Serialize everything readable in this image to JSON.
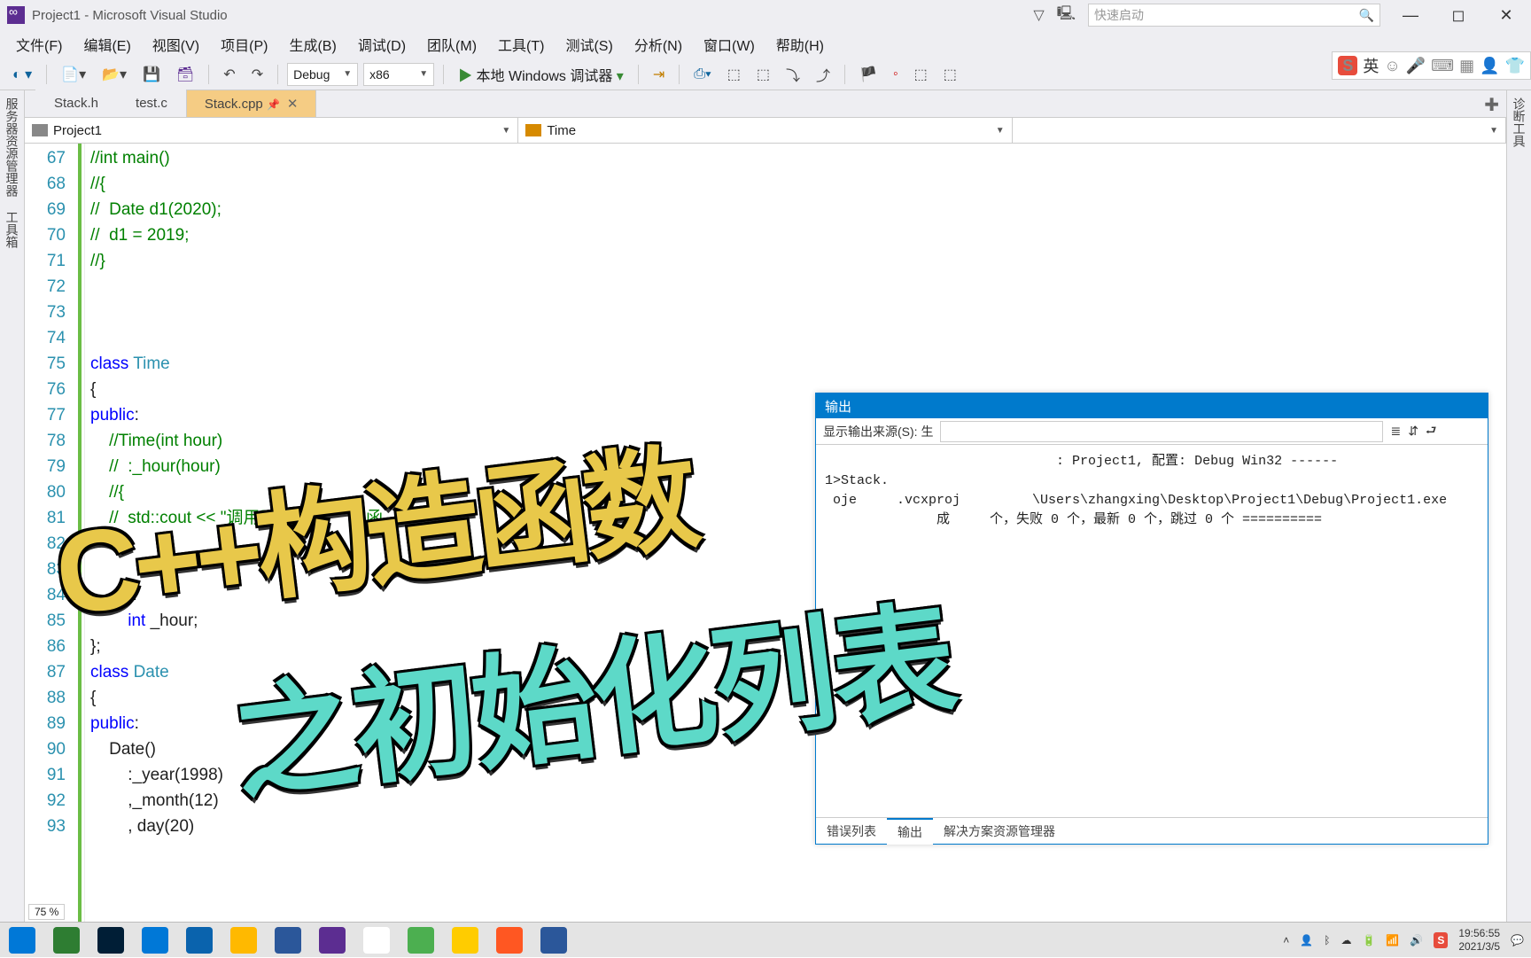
{
  "title": "Project1 - Microsoft Visual Studio",
  "quicklaunch_placeholder": "快速启动",
  "menu": [
    "文件(F)",
    "编辑(E)",
    "视图(V)",
    "项目(P)",
    "生成(B)",
    "调试(D)",
    "团队(M)",
    "工具(T)",
    "测试(S)",
    "分析(N)",
    "窗口(W)",
    "帮助(H)"
  ],
  "config": {
    "build": "Debug",
    "platform": "x86",
    "debugger": "本地 Windows 调试器"
  },
  "tabs": [
    {
      "label": "Stack.h",
      "active": false
    },
    {
      "label": "test.c",
      "active": false
    },
    {
      "label": "Stack.cpp",
      "active": true,
      "pinned": true
    }
  ],
  "nav": {
    "scope": "Project1",
    "member": "Time"
  },
  "left_rail": [
    "服务器资源管理器",
    "工具箱"
  ],
  "right_rail": "诊断工具",
  "line_start": 67,
  "code_lines": [
    {
      "n": 67,
      "seg": [
        {
          "t": "//int main()",
          "c": "cm"
        }
      ]
    },
    {
      "n": 68,
      "seg": [
        {
          "t": "//{",
          "c": "cm"
        }
      ]
    },
    {
      "n": 69,
      "seg": [
        {
          "t": "//  Date d1(2020);",
          "c": "cm"
        }
      ]
    },
    {
      "n": 70,
      "seg": [
        {
          "t": "//  d1 = 2019;",
          "c": "cm"
        }
      ]
    },
    {
      "n": 71,
      "seg": [
        {
          "t": "//}",
          "c": "cm"
        }
      ]
    },
    {
      "n": 72,
      "seg": [
        {
          "t": ""
        }
      ]
    },
    {
      "n": 73,
      "seg": [
        {
          "t": ""
        }
      ]
    },
    {
      "n": 74,
      "seg": [
        {
          "t": ""
        }
      ]
    },
    {
      "n": 75,
      "seg": [
        {
          "t": "class ",
          "c": "kw"
        },
        {
          "t": "Time",
          "c": "tp"
        }
      ]
    },
    {
      "n": 76,
      "seg": [
        {
          "t": "{"
        }
      ]
    },
    {
      "n": 77,
      "seg": [
        {
          "t": "public",
          "c": "kw"
        },
        {
          "t": ":"
        }
      ]
    },
    {
      "n": 78,
      "seg": [
        {
          "t": "    //Time(int hour)",
          "c": "cm"
        }
      ]
    },
    {
      "n": 79,
      "seg": [
        {
          "t": "    //  :_hour(hour)",
          "c": "cm"
        }
      ]
    },
    {
      "n": 80,
      "seg": [
        {
          "t": "    //{",
          "c": "cm"
        }
      ]
    },
    {
      "n": 81,
      "seg": [
        {
          "t": "    //  std::cout << \"调用了Time的    造函   \"       :en",
          "c": "cm"
        }
      ]
    },
    {
      "n": 82,
      "seg": [
        {
          "t": "    //}",
          "c": "cm"
        }
      ]
    },
    {
      "n": 83,
      "seg": [
        {
          "t": ""
        }
      ]
    },
    {
      "n": 84,
      "seg": [
        {
          "t": "      te:"
        }
      ]
    },
    {
      "n": 85,
      "seg": [
        {
          "t": "        int",
          "c": "kw"
        },
        {
          "t": " _hour;"
        }
      ]
    },
    {
      "n": 86,
      "seg": [
        {
          "t": "};"
        }
      ]
    },
    {
      "n": 87,
      "seg": [
        {
          "t": "class ",
          "c": "kw"
        },
        {
          "t": "Date",
          "c": "tp"
        }
      ]
    },
    {
      "n": 88,
      "seg": [
        {
          "t": "{"
        }
      ]
    },
    {
      "n": 89,
      "seg": [
        {
          "t": "public",
          "c": "kw"
        },
        {
          "t": ":"
        }
      ]
    },
    {
      "n": 90,
      "seg": [
        {
          "t": "    Date()"
        }
      ]
    },
    {
      "n": 91,
      "seg": [
        {
          "t": "        :_year(1998)"
        }
      ]
    },
    {
      "n": 92,
      "seg": [
        {
          "t": "        ,_month(12)"
        }
      ]
    },
    {
      "n": 93,
      "seg": [
        {
          "t": "        , day(20)"
        }
      ]
    }
  ],
  "zoom": "75 %",
  "output": {
    "title": "输出",
    "toolbar_label": "显示输出来源(S): 生",
    "lines": [
      "                             : Project1, 配置: Debug Win32 ------",
      "1>Stack.",
      " oje     .vcxproj         \\Users\\zhangxing\\Desktop\\Project1\\Debug\\Project1.exe",
      "              成     个，失败 0 个，最新 0 个，跳过 0 个 =========="
    ],
    "tabs": [
      "错误列表",
      "输出",
      "解决方案资源管理器"
    ],
    "active_tab": 1
  },
  "overlay": {
    "line1": "C++构造函数",
    "line2": "之初始化列表"
  },
  "taskbar": {
    "items": [
      {
        "name": "start",
        "bg": "#0078d7"
      },
      {
        "name": "translate",
        "bg": "#2e7d32"
      },
      {
        "name": "photoshop",
        "bg": "#001e36"
      },
      {
        "name": "vscode",
        "bg": "#0078d7"
      },
      {
        "name": "edge",
        "bg": "#0a63ad"
      },
      {
        "name": "explorer",
        "bg": "#ffb900"
      },
      {
        "name": "pdf",
        "bg": "#2b579a"
      },
      {
        "name": "visualstudio",
        "bg": "#5c2d91"
      },
      {
        "name": "chrome",
        "bg": "#fff"
      },
      {
        "name": "camtasia",
        "bg": "#4caf50"
      },
      {
        "name": "potplayer",
        "bg": "#ffcc00"
      },
      {
        "name": "cleaner",
        "bg": "#ff5722"
      },
      {
        "name": "word",
        "bg": "#2b579a"
      }
    ],
    "time": "19:56:55",
    "date": "2021/3/5"
  },
  "ime": "英"
}
